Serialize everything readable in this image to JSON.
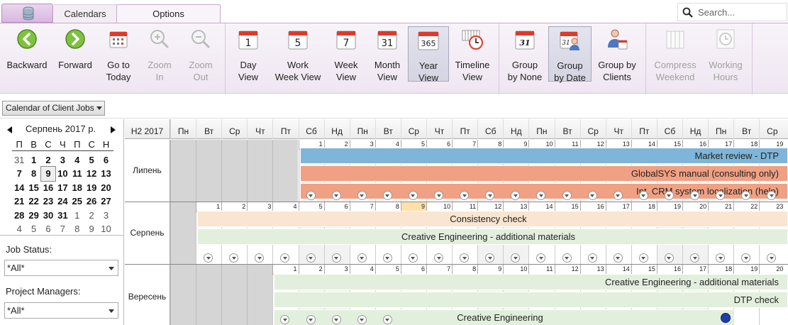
{
  "tabs": {
    "calendars": "Calendars",
    "options": "Options"
  },
  "search": {
    "placeholder": "Search..."
  },
  "ribbon": {
    "backward": [
      "Backward",
      ""
    ],
    "forward": [
      "Forward",
      ""
    ],
    "goto_today": [
      "Go to",
      "Today"
    ],
    "zoom_in": [
      "Zoom",
      "In"
    ],
    "zoom_out": [
      "Zoom",
      "Out"
    ],
    "day_view": [
      "Day",
      "View"
    ],
    "work_week_view": [
      "Work",
      "Week View"
    ],
    "week_view": [
      "Week",
      "View"
    ],
    "month_view": [
      "Month",
      "View"
    ],
    "year_view": [
      "Year",
      "View"
    ],
    "timeline_view": [
      "Timeline",
      "View"
    ],
    "group_none": [
      "Group",
      "by None"
    ],
    "group_date": [
      "Group",
      "by Date"
    ],
    "group_clients": [
      "Group by",
      "Clients"
    ],
    "compress_weekend": [
      "Compress",
      "Weekend"
    ],
    "working_hours": [
      "Working",
      "Hours"
    ],
    "icon_numbers": {
      "day": "1",
      "work_week": "5",
      "week": "7",
      "month": "31",
      "year": "365",
      "group_none": "31",
      "group_date": "31"
    }
  },
  "calendar_selector": "Calendar of Client Jobs",
  "mini_calendar": {
    "title": "Серпень 2017 р.",
    "weekdays": [
      "П",
      "В",
      "С",
      "Ч",
      "П",
      "С",
      "Н"
    ],
    "weeks": [
      [
        "31",
        "1",
        "2",
        "3",
        "4",
        "5",
        "6"
      ],
      [
        "7",
        "8",
        "9",
        "10",
        "11",
        "12",
        "13"
      ],
      [
        "14",
        "15",
        "16",
        "17",
        "18",
        "19",
        "20"
      ],
      [
        "21",
        "22",
        "23",
        "24",
        "25",
        "26",
        "27"
      ],
      [
        "28",
        "29",
        "30",
        "31",
        "1",
        "2",
        "3"
      ],
      [
        "4",
        "5",
        "6",
        "7",
        "8",
        "9",
        "10"
      ]
    ]
  },
  "filters": {
    "job_status_label": "Job Status:",
    "job_status_value": "*All*",
    "project_managers_label": "Project Managers:",
    "project_managers_value": "*All*"
  },
  "timeline": {
    "corner": "H2 2017",
    "day_headers": [
      "Пн",
      "Вт",
      "Ср",
      "Чт",
      "Пт",
      "Сб",
      "Нд",
      "Пн",
      "Вт",
      "Ср",
      "Чт",
      "Пт",
      "Сб",
      "Нд",
      "Пн",
      "Вт",
      "Ср",
      "Чт",
      "Пт",
      "Сб",
      "Нд",
      "Пн",
      "Вт",
      "Ср"
    ],
    "months": [
      {
        "label": "Липень",
        "days": [
          "1",
          "2",
          "3",
          "4",
          "5",
          "6",
          "7",
          "8",
          "9",
          "10",
          "11",
          "12",
          "13",
          "14",
          "15",
          "16",
          "17",
          "18",
          "19"
        ],
        "bars": [
          "Market review - DTP",
          "GlobalSYS manual (consulting only)",
          "Int. CRM system localization (help)"
        ]
      },
      {
        "label": "Серпень",
        "days": [
          "1",
          "2",
          "3",
          "4",
          "5",
          "6",
          "7",
          "8",
          "9",
          "10",
          "11",
          "12",
          "13",
          "14",
          "15",
          "16",
          "17",
          "18",
          "19",
          "20",
          "21",
          "22",
          "23"
        ],
        "bars": [
          "Consistency check",
          "Creative Engineering - additional materials"
        ]
      },
      {
        "label": "Вересень",
        "days": [
          "1",
          "2",
          "3",
          "4",
          "5",
          "6",
          "7",
          "8",
          "9",
          "10",
          "11",
          "12",
          "13",
          "14",
          "15",
          "16",
          "17",
          "18",
          "19",
          "20"
        ],
        "bars": [
          "Creative Engineering - additional materials",
          "DTP check",
          "Creative Engineering"
        ]
      }
    ]
  }
}
